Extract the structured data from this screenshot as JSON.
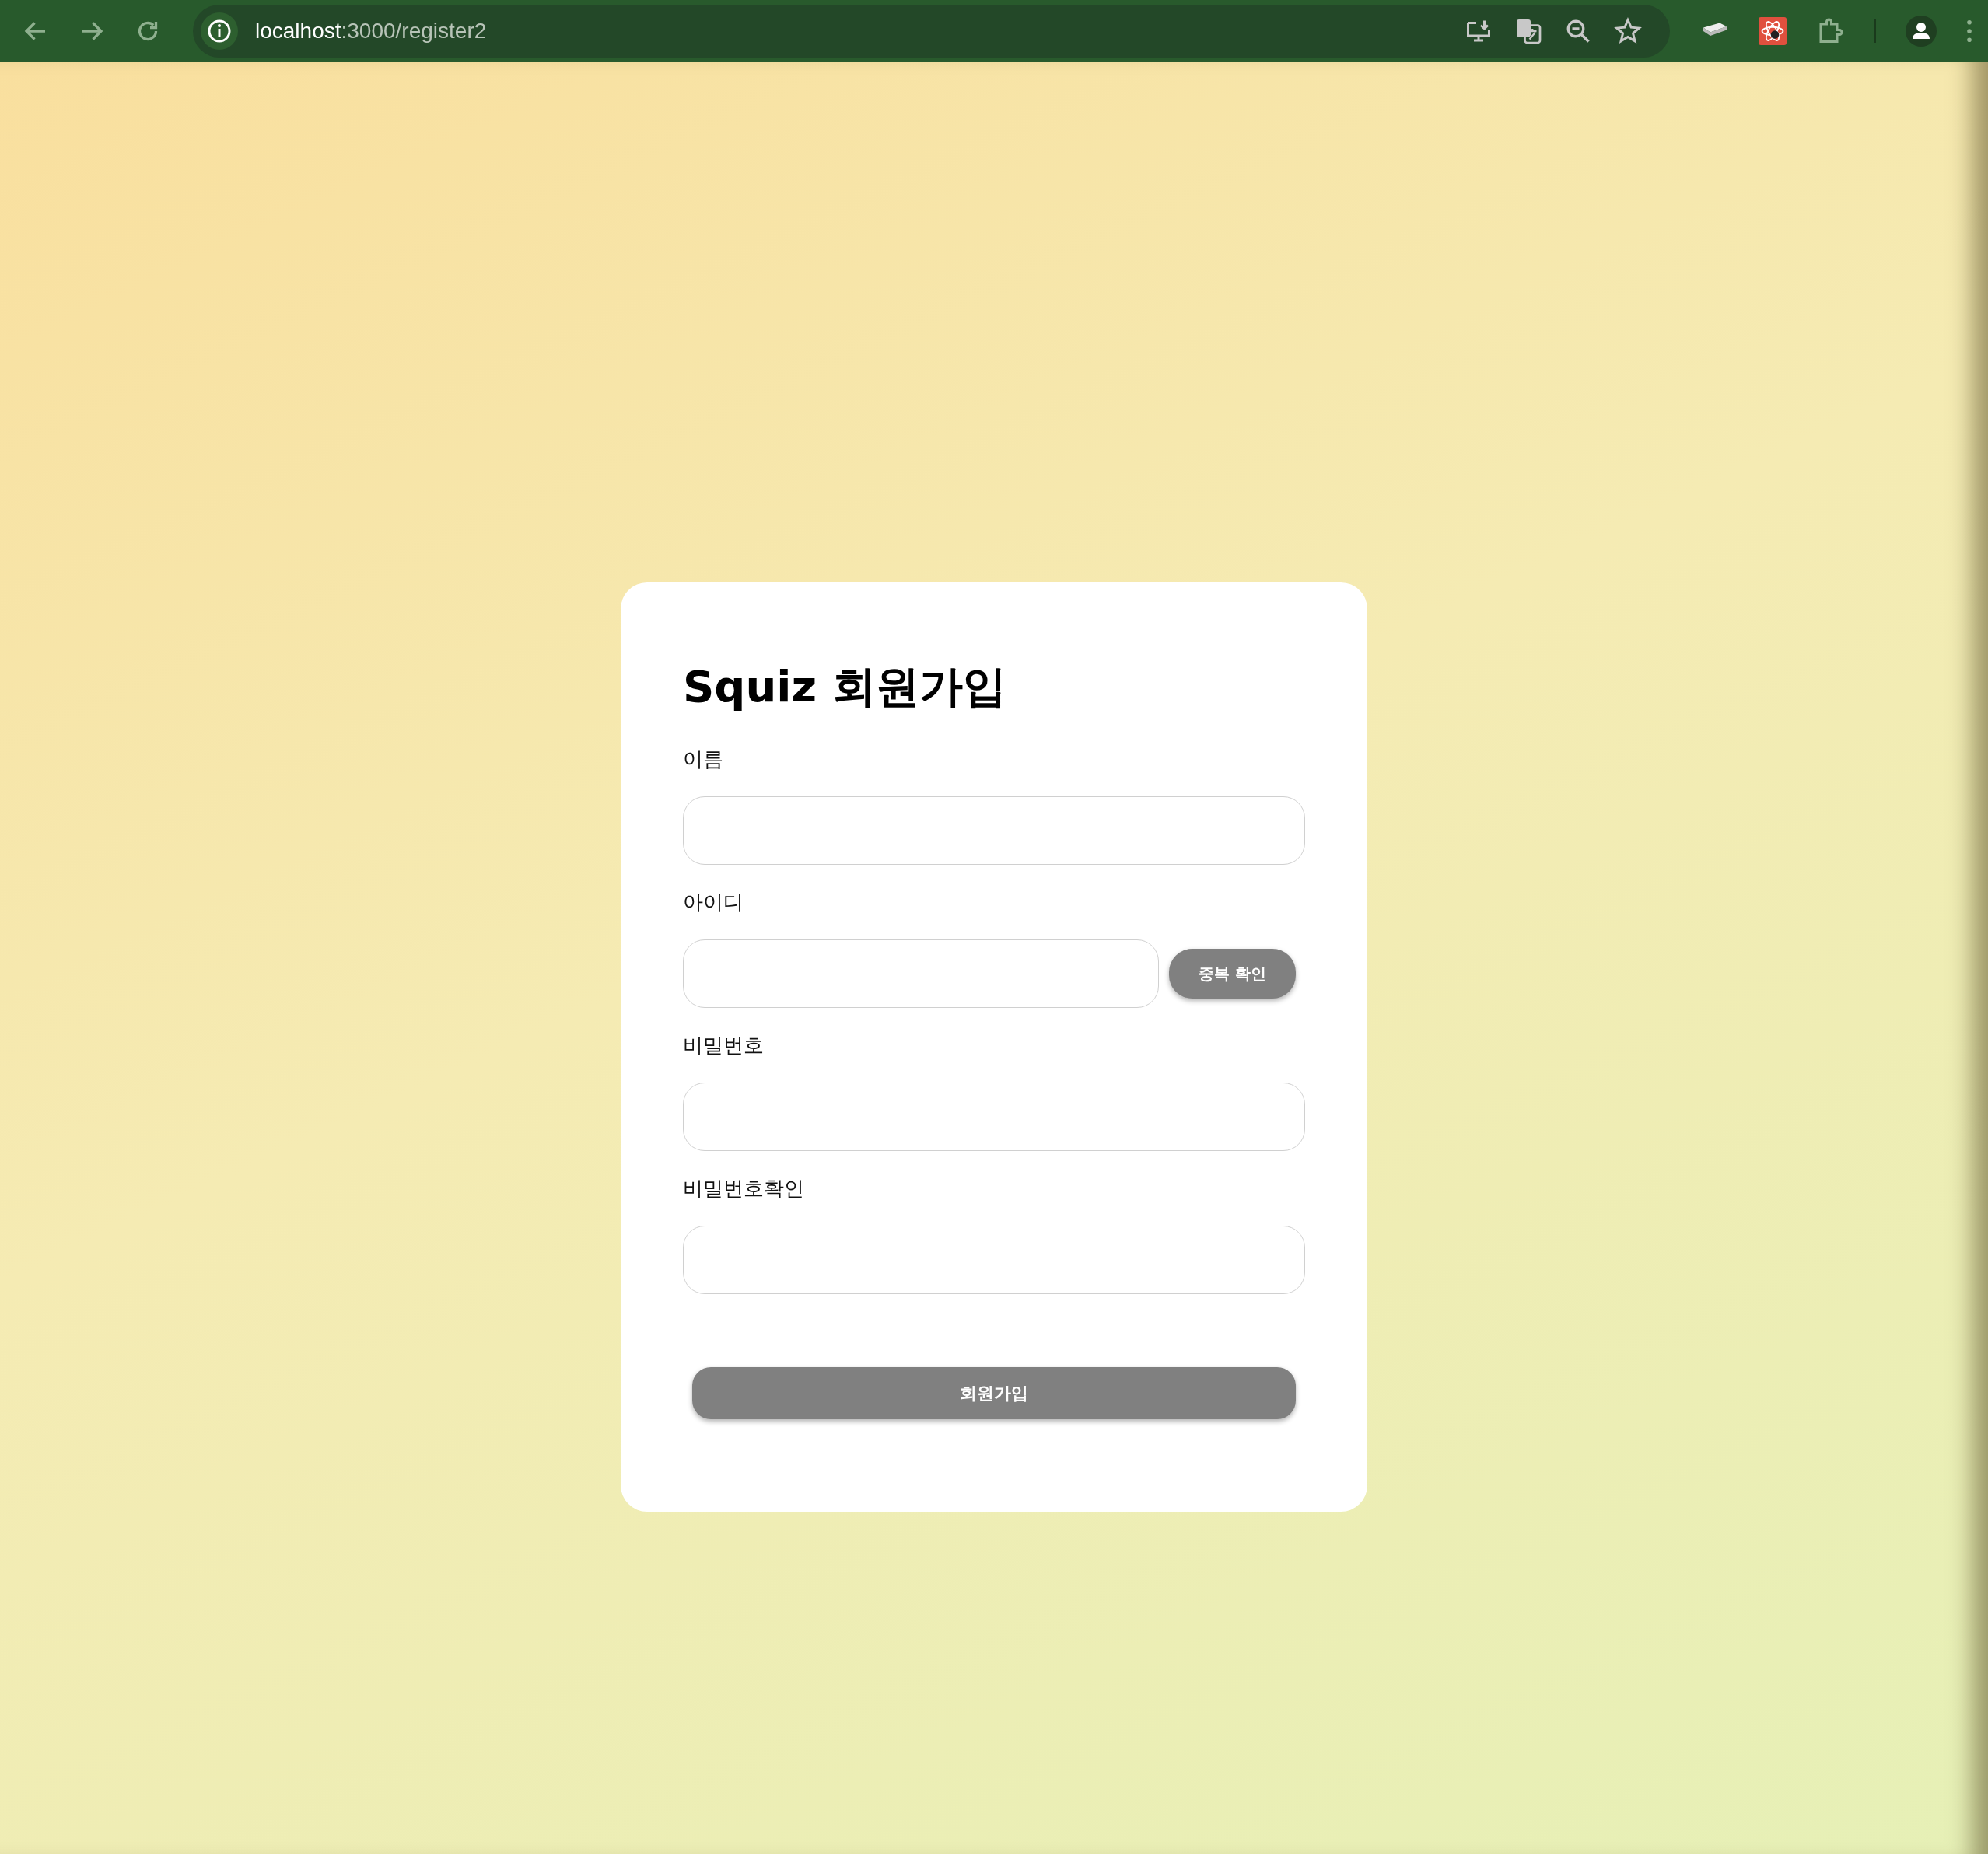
{
  "browser": {
    "url_host": "localhost",
    "url_path": ":3000/register2"
  },
  "form": {
    "title": "Squiz 회원가입",
    "fields": [
      {
        "kind": "input",
        "label": "이름"
      },
      {
        "kind": "input_with_button",
        "label": "아이디",
        "button": "중복 확인"
      },
      {
        "kind": "input",
        "label": "비밀번호"
      },
      {
        "kind": "input",
        "label": "비밀번호확인"
      }
    ],
    "submit": "회원가입"
  }
}
